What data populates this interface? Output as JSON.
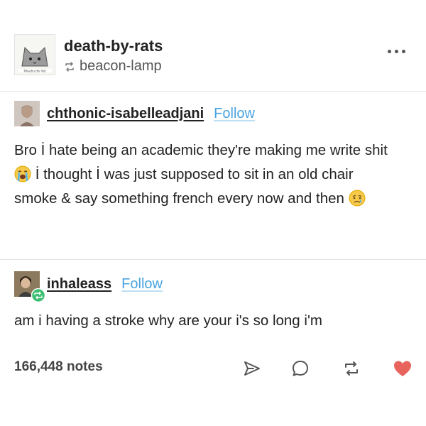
{
  "post": {
    "blog_name": "death-by-rats",
    "reblogged_from": "beacon-lamp",
    "avatar_caption": "Pikachu the Vet"
  },
  "reblogs": [
    {
      "username": "chthonic-isabelleadjani",
      "follow_label": "Follow",
      "text_parts": [
        "Bro İ hate being an academic they're making me write shit",
        "İ thought İ was just supposed to sit in an old chair smoke & say something french every now and then"
      ]
    },
    {
      "username": "inhaleass",
      "follow_label": "Follow",
      "text": "am i having a stroke why are your i's so long i'm"
    }
  ],
  "footer": {
    "notes": "166,448 notes"
  },
  "icons": {
    "share": "paper-plane-icon",
    "reply": "speech-bubble-icon",
    "reblog": "reblog-arrows-icon",
    "like": "heart-icon",
    "more": "ellipsis-icon"
  },
  "colors": {
    "follow": "#4aa3df",
    "like": "#e8635c",
    "reblog_badge": "#3cbf73"
  }
}
